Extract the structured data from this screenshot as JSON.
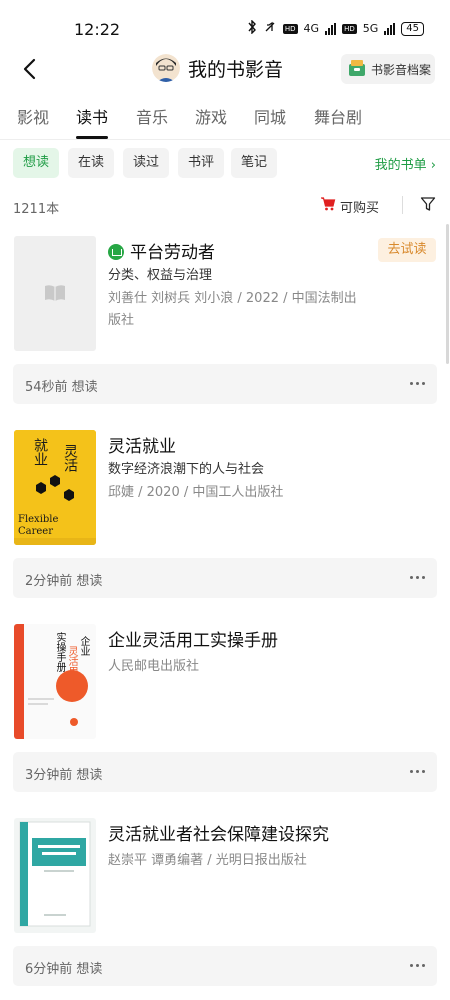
{
  "status": {
    "time": "12:22",
    "battery": "45",
    "net1": "4G",
    "net2": "5G"
  },
  "header": {
    "title": "我的书影音",
    "archive_label": "书影音档案"
  },
  "tabs": [
    {
      "label": "影视"
    },
    {
      "label": "读书"
    },
    {
      "label": "音乐"
    },
    {
      "label": "游戏"
    },
    {
      "label": "同城"
    },
    {
      "label": "舞台剧"
    }
  ],
  "filters": [
    {
      "label": "想读"
    },
    {
      "label": "在读"
    },
    {
      "label": "读过"
    },
    {
      "label": "书评"
    },
    {
      "label": "笔记"
    }
  ],
  "my_books_label": "我的书单",
  "count_label": "1211本",
  "buyable_label": "可购买",
  "trial_label": "去试读",
  "books": [
    {
      "title": "平台劳动者",
      "subtitle": "分类、权益与治理",
      "meta": "刘善仕 刘树兵 刘小浪 / 2022 / 中国法制出版社",
      "footer": "54秒前 想读"
    },
    {
      "title": "灵活就业",
      "subtitle": "数字经济浪潮下的人与社会",
      "meta": "邱婕 / 2020 / 中国工人出版社",
      "footer": "2分钟前 想读",
      "cover_text": {
        "left": "就业",
        "right": "灵活",
        "en1": "Flexible",
        "en2": "Career"
      }
    },
    {
      "title": "企业灵活用工实操手册",
      "subtitle": "",
      "meta": "人民邮电出版社",
      "footer": "3分钟前 想读",
      "cover_text": {
        "a": "企业",
        "b": "灵活用工",
        "c": "实操手册"
      }
    },
    {
      "title": "灵活就业者社会保障建设探究",
      "subtitle": "",
      "meta": "赵崇平 谭勇编著 / 光明日报出版社",
      "footer": "6分钟前 想读"
    }
  ],
  "colors": {
    "accent": "#1f9c45",
    "trial": "#d8892c",
    "cover_yellow": "#f4c21a",
    "cover_orange": "#ee5a2a",
    "cover_teal": "#2fa7a3"
  }
}
